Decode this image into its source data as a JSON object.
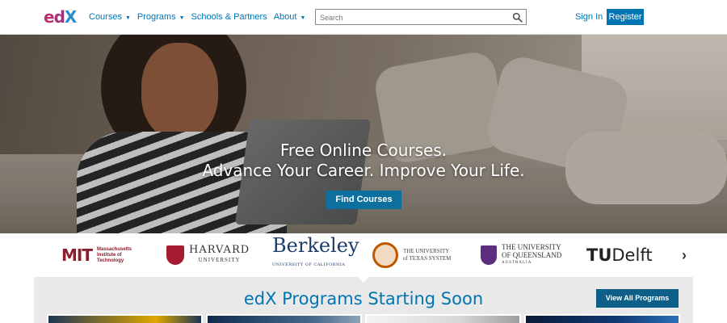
{
  "header": {
    "logo": {
      "e": "e",
      "d": "d",
      "x": "X"
    },
    "nav": [
      {
        "label": "Courses",
        "has_caret": true
      },
      {
        "label": "Programs",
        "has_caret": true
      },
      {
        "label": "Schools & Partners",
        "has_caret": false
      },
      {
        "label": "About",
        "has_caret": true
      }
    ],
    "search": {
      "placeholder": "Search",
      "value": "",
      "icon": "search-icon"
    },
    "sign_in_label": "Sign In",
    "register_label": "Register"
  },
  "hero": {
    "line1": "Free Online Courses.",
    "line2": "Advance Your Career. Improve Your Life.",
    "cta_label": "Find Courses"
  },
  "partners": {
    "items": [
      {
        "id": "mit",
        "mark": "MIT",
        "line1": "Massachusetts",
        "line2": "Institute of",
        "line3": "Technology"
      },
      {
        "id": "harvard",
        "name": "HARVARD",
        "sub": "UNIVERSITY"
      },
      {
        "id": "berkeley",
        "name": "Berkeley",
        "sub": "UNIVERSITY OF CALIFORNIA"
      },
      {
        "id": "ut",
        "line1": "THE UNIVERSITY",
        "line2": "of TEXAS SYSTEM"
      },
      {
        "id": "uq",
        "line1": "THE UNIVERSITY",
        "line2": "OF QUEENSLAND",
        "sub": "AUSTRALIA"
      },
      {
        "id": "tudelft",
        "t": "TU",
        "name": "Delft"
      }
    ],
    "next_icon": "chevron-right-icon"
  },
  "programs": {
    "title": "edX Programs Starting Soon",
    "view_all_label": "View All Programs"
  },
  "colors": {
    "brand_blue": "#0075b4",
    "brand_magenta": "#b8316f",
    "button_dark": "#0d6f9e"
  }
}
